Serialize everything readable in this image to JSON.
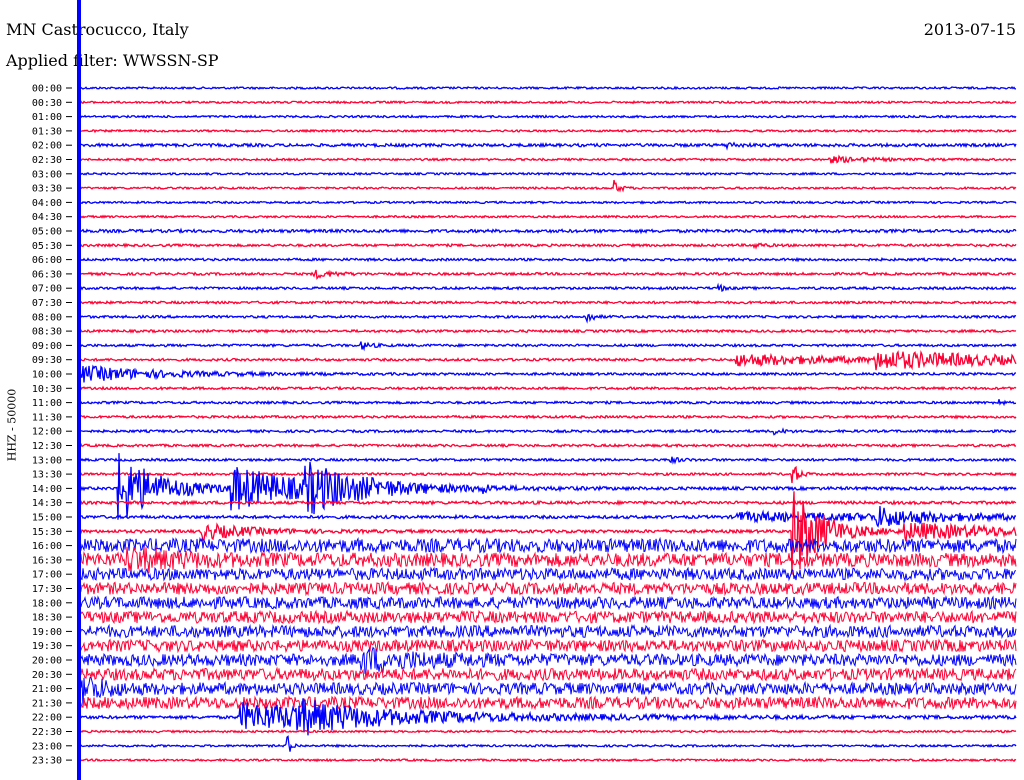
{
  "header": {
    "station": "MN Castrocucco, Italy",
    "date": "2013-07-15",
    "filter": "Applied filter: WWSSN-SP"
  },
  "axis_label": "HHZ - 50000",
  "chart_data": {
    "type": "line",
    "title": "MN Castrocucco, Italy",
    "subtitle": "Applied filter: WWSSN-SP",
    "ylabel": "HHZ - 50000",
    "y_ticks": [
      "00:00",
      "00:30",
      "01:00",
      "01:30",
      "02:00",
      "02:30",
      "03:00",
      "03:30",
      "04:00",
      "04:30",
      "05:00",
      "05:30",
      "06:00",
      "06:30",
      "07:00",
      "07:30",
      "08:00",
      "08:30",
      "09:00",
      "09:30",
      "10:00",
      "10:30",
      "11:00",
      "11:30",
      "12:00",
      "12:30",
      "13:00",
      "13:30",
      "14:00",
      "14:30",
      "15:00",
      "15:30",
      "16:00",
      "16:30",
      "17:00",
      "17:30",
      "18:00",
      "18:30",
      "19:00",
      "19:30",
      "20:00",
      "20:30",
      "21:00",
      "21:30",
      "22:00",
      "22:30",
      "23:00",
      "23:30"
    ],
    "trace_colors": [
      "#0000ff",
      "#ff0033"
    ],
    "noise_levels": [
      1,
      1,
      1,
      1,
      1.5,
      1,
      1,
      1,
      1,
      1,
      1.5,
      1.2,
      1.2,
      1.2,
      1.2,
      1.2,
      1.2,
      1.2,
      1.2,
      1.2,
      1.2,
      1.2,
      1.2,
      1.2,
      1.2,
      1.2,
      1.2,
      1.2,
      1.5,
      1.5,
      1.5,
      1.5,
      7,
      7,
      6,
      6,
      6,
      6,
      6,
      6,
      6,
      6,
      6,
      6,
      1.5,
      1,
      1,
      1
    ],
    "events": [
      {
        "row": 4,
        "x": 0.69,
        "amp": 3,
        "dur": 0.01
      },
      {
        "row": 5,
        "x": 0.8,
        "amp": 3,
        "dur": 0.04
      },
      {
        "row": 7,
        "x": 0.57,
        "amp": 8,
        "dur": 0.006
      },
      {
        "row": 11,
        "x": 0.72,
        "amp": 3,
        "dur": 0.008
      },
      {
        "row": 13,
        "x": 0.25,
        "amp": 4,
        "dur": 0.02
      },
      {
        "row": 14,
        "x": 0.68,
        "amp": 6,
        "dur": 0.005
      },
      {
        "row": 16,
        "x": 0.54,
        "amp": 8,
        "dur": 0.006
      },
      {
        "row": 18,
        "x": 0.3,
        "amp": 4,
        "dur": 0.01
      },
      {
        "row": 19,
        "x": 0.7,
        "amp": 6,
        "dur": 0.12
      },
      {
        "row": 19,
        "x": 0.85,
        "amp": 8,
        "dur": 0.15
      },
      {
        "row": 20,
        "x": 0.0,
        "amp": 8,
        "dur": 0.08
      },
      {
        "row": 22,
        "x": 0.98,
        "amp": 5,
        "dur": 0.004
      },
      {
        "row": 24,
        "x": 0.74,
        "amp": 3,
        "dur": 0.01
      },
      {
        "row": 26,
        "x": 0.63,
        "amp": 3,
        "dur": 0.01
      },
      {
        "row": 27,
        "x": 0.76,
        "amp": 14,
        "dur": 0.006
      },
      {
        "row": 28,
        "x": 0.04,
        "amp": 38,
        "dur": 0.04
      },
      {
        "row": 28,
        "x": 0.16,
        "amp": 22,
        "dur": 0.08
      },
      {
        "row": 28,
        "x": 0.24,
        "amp": 20,
        "dur": 0.06
      },
      {
        "row": 28,
        "x": 0.43,
        "amp": 4,
        "dur": 0.005
      },
      {
        "row": 30,
        "x": 0.7,
        "amp": 4,
        "dur": 0.3
      },
      {
        "row": 30,
        "x": 0.85,
        "amp": 9,
        "dur": 0.04
      },
      {
        "row": 31,
        "x": 0.76,
        "amp": 50,
        "dur": 0.03
      },
      {
        "row": 31,
        "x": 0.13,
        "amp": 8,
        "dur": 0.05
      },
      {
        "row": 31,
        "x": 0.88,
        "amp": 8,
        "dur": 0.13
      },
      {
        "row": 33,
        "x": 0.05,
        "amp": 10,
        "dur": 0.05
      },
      {
        "row": 40,
        "x": 0.3,
        "amp": 10,
        "dur": 0.06
      },
      {
        "row": 42,
        "x": 0.0,
        "amp": 16,
        "dur": 0.02
      },
      {
        "row": 44,
        "x": 0.17,
        "amp": 14,
        "dur": 0.18
      },
      {
        "row": 44,
        "x": 0.23,
        "amp": 10,
        "dur": 0.05
      },
      {
        "row": 46,
        "x": 0.22,
        "amp": 16,
        "dur": 0.004
      }
    ],
    "cursor_color": "#0000ff"
  }
}
